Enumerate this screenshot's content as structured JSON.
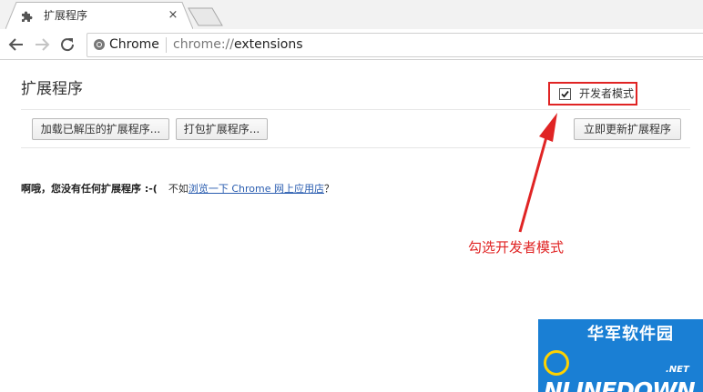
{
  "browser": {
    "tab": {
      "title": "扩展程序",
      "icon": "puzzle-icon",
      "close_glyph": "×"
    },
    "toolbar": {
      "back_icon": "back-arrow-icon",
      "forward_icon": "forward-arrow-icon",
      "reload_icon": "reload-icon",
      "site_label": "Chrome",
      "url_scheme": "chrome://",
      "url_host": "extensions"
    }
  },
  "page": {
    "title": "扩展程序",
    "developer_mode": {
      "label": "开发者模式",
      "checked": true
    },
    "buttons": {
      "load_unpacked": "加载已解压的扩展程序...",
      "pack": "打包扩展程序...",
      "update_now": "立即更新扩展程序"
    },
    "empty_state": {
      "message": "啊哦，您没有任何扩展程序 :-(",
      "prefix": "不如",
      "link": "浏览一下 Chrome 网上应用店",
      "suffix": "？"
    }
  },
  "annotation": {
    "text": "勾选开发者模式",
    "color": "#e02424"
  },
  "watermark": {
    "chinese": "华军软件园",
    "english_o": "O",
    "english": "NLINEDOWN",
    "suffix": ".NET"
  },
  "colors": {
    "accent_red": "#e02424",
    "link_blue": "#2a5db0",
    "logo_blue": "#1a7fd4"
  }
}
